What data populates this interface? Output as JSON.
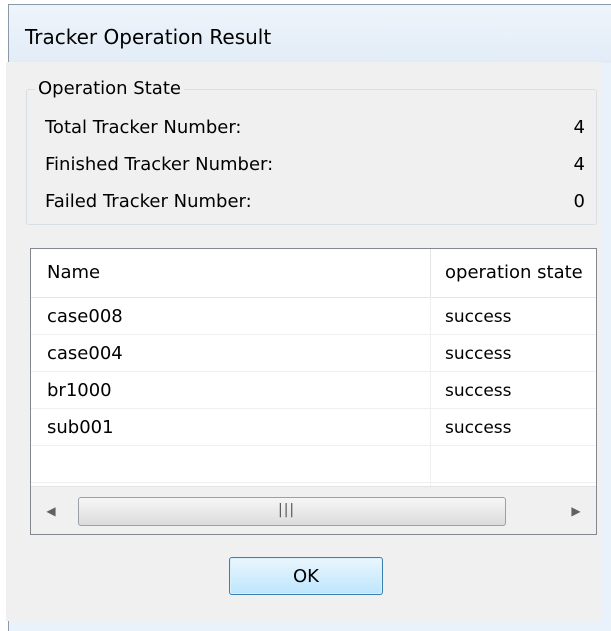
{
  "window": {
    "title": "Tracker Operation Result"
  },
  "operation_state": {
    "legend": "Operation State",
    "rows": [
      {
        "label": "Total Tracker Number:",
        "value": "4"
      },
      {
        "label": "Finished Tracker Number:",
        "value": "4"
      },
      {
        "label": "Failed Tracker Number:",
        "value": "0"
      }
    ]
  },
  "list": {
    "columns": [
      "Name",
      "operation state"
    ],
    "rows": [
      {
        "name": "case008",
        "state": "success"
      },
      {
        "name": "case004",
        "state": "success"
      },
      {
        "name": "br1000",
        "state": "success"
      },
      {
        "name": "sub001",
        "state": "success"
      }
    ],
    "scrollbar": {
      "left_arrow": "◀",
      "right_arrow": "▶",
      "grip": "|||"
    }
  },
  "buttons": {
    "ok_label": "OK"
  }
}
